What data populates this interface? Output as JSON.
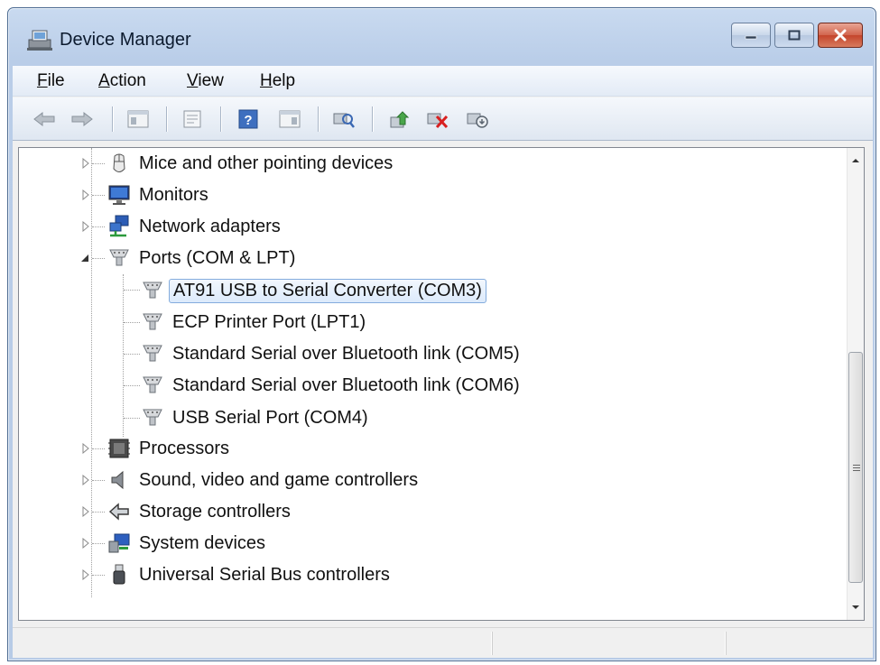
{
  "window": {
    "title": "Device Manager"
  },
  "caption_buttons": [
    "minimize-icon",
    "maximize-icon",
    "close-icon"
  ],
  "menu": {
    "file": {
      "accel": "F",
      "rest": "ile"
    },
    "action": {
      "accel": "A",
      "rest": "ction"
    },
    "view": {
      "accel": "V",
      "rest": "iew"
    },
    "help": {
      "accel": "H",
      "rest": "elp"
    }
  },
  "toolbar_icons": [
    "back-arrow-icon",
    "forward-arrow-icon",
    "show-hide-console-tree-icon",
    "properties-icon",
    "help-icon",
    "show-hide-action-pane-icon",
    "scan-hardware-changes-icon",
    "update-driver-icon",
    "uninstall-device-icon",
    "disable-device-icon"
  ],
  "tree": {
    "mice": "Mice and other pointing devices",
    "monitors": "Monitors",
    "network": "Network adapters",
    "ports": "Ports (COM & LPT)",
    "port_children": [
      "AT91 USB to Serial Converter (COM3)",
      "ECP Printer Port (LPT1)",
      "Standard Serial over Bluetooth link (COM5)",
      "Standard Serial over Bluetooth link (COM6)",
      "USB Serial Port (COM4)"
    ],
    "processors": "Processors",
    "sound": "Sound, video and game controllers",
    "storage": "Storage controllers",
    "system": "System devices",
    "usb": "Universal Serial Bus controllers"
  },
  "colors": {
    "selection_border": "#84acdd",
    "titlebar": "#c9daf0",
    "close_button": "#c4452c"
  }
}
